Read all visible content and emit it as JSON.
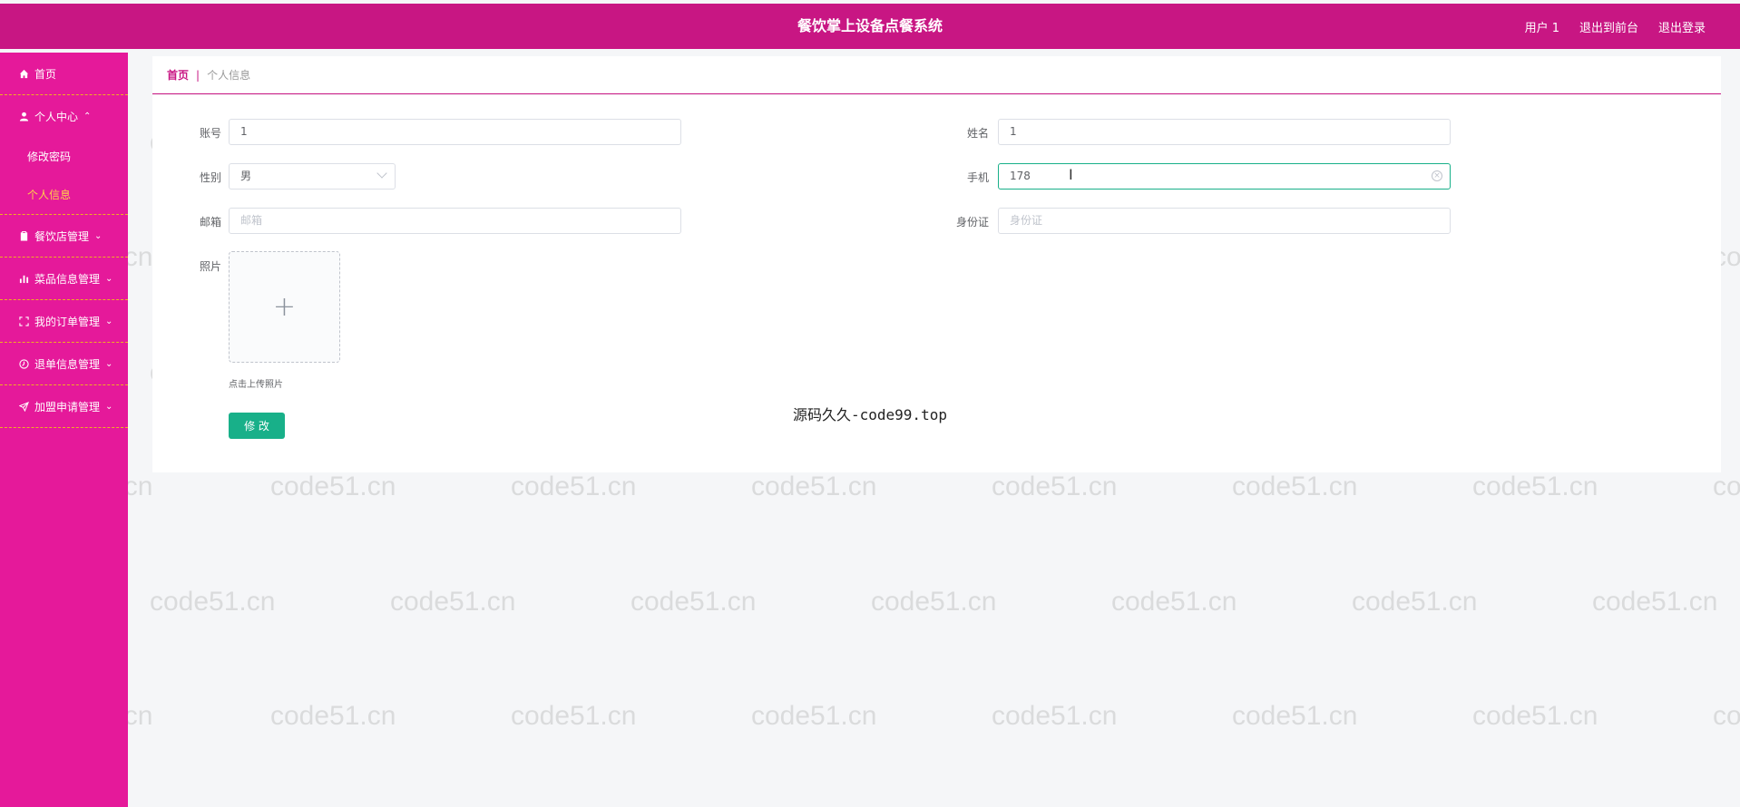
{
  "header": {
    "title": "餐饮掌上设备点餐系统",
    "user": "用户 1",
    "to_front": "退出到前台",
    "logout": "退出登录"
  },
  "sidebar": {
    "items": [
      {
        "label": "首页",
        "icon": "home-icon"
      },
      {
        "label": "个人中心",
        "icon": "user-icon",
        "expanded": true,
        "children": [
          {
            "label": "修改密码"
          },
          {
            "label": "个人信息",
            "active": true
          }
        ]
      },
      {
        "label": "餐饮店管理",
        "icon": "clipboard-icon"
      },
      {
        "label": "菜品信息管理",
        "icon": "bar-chart-icon"
      },
      {
        "label": "我的订单管理",
        "icon": "scan-icon"
      },
      {
        "label": "退单信息管理",
        "icon": "clock-icon"
      },
      {
        "label": "加盟申请管理",
        "icon": "send-icon"
      }
    ]
  },
  "breadcrumb": {
    "home": "首页",
    "separator": "|",
    "current": "个人信息"
  },
  "form": {
    "account": {
      "label": "账号",
      "value": "1"
    },
    "name": {
      "label": "姓名",
      "value": "1"
    },
    "gender": {
      "label": "性别",
      "value": "男"
    },
    "phone": {
      "label": "手机",
      "value": "178"
    },
    "email": {
      "label": "邮箱",
      "placeholder": "邮箱"
    },
    "id_card": {
      "label": "身份证",
      "placeholder": "身份证"
    },
    "photo": {
      "label": "照片",
      "tip": "点击上传照片"
    },
    "submit_label": "修 改"
  },
  "overlay_text": "源码久久-code99.top",
  "watermark": "code51.cn",
  "colors": {
    "header": "#c81683",
    "sidebar": "#e5199a",
    "accent": "#18b089",
    "active_sub": "#ffd24a"
  }
}
